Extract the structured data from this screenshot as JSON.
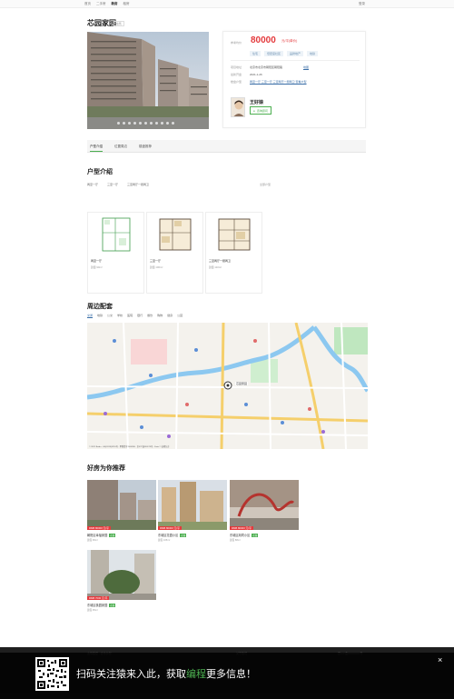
{
  "nav": {
    "links": [
      "首页",
      "二手房",
      "新房",
      "租房"
    ],
    "active_index": 2,
    "right": "登录"
  },
  "listing": {
    "title": "芯园家园",
    "title_tag": "在售"
  },
  "price_card": {
    "price_label": "参考均价",
    "price": "80000",
    "price_unit": "元/平(单价)",
    "tags": [
      "住宅",
      "低密度社区",
      "品牌地产",
      "地铁"
    ],
    "rows": [
      {
        "label": "项目地址",
        "value": "北京市北京市朝阳区朝阳路",
        "link": "地图"
      },
      {
        "label": "最新开盘",
        "value": "2021-1-26",
        "link": ""
      },
      {
        "label": "楼盘户型",
        "value": "",
        "link": "两室一厅  三室一厅  三室两厅一厨两卫  查看户型"
      }
    ],
    "agent_name": "王好娘",
    "agent_button": "咨询顾问"
  },
  "tabs": [
    "户型介绍",
    "位置周边",
    "楼盘推荐"
  ],
  "layout_section": {
    "title": "户型介绍",
    "filters": [
      "两室一厅",
      "三室一厅",
      "三室两厅一厨两卫"
    ],
    "all_link": "全部户型",
    "plans": [
      {
        "name": "两室一厅",
        "area": "建面 90m²"
      },
      {
        "name": "三室一厅",
        "area": "建面 100m²"
      },
      {
        "name": "三室两厅一厨两卫",
        "area": "建面 110m²"
      }
    ]
  },
  "map_section": {
    "title": "周边配套",
    "categories": [
      "交通",
      "地铁",
      "公交",
      "学校",
      "医院",
      "银行",
      "餐饮",
      "购物",
      "健身",
      "公园"
    ],
    "active_index": 0,
    "marker_label": "芯园家园",
    "copyright": "© 2021 Baidu - GS(2019)5218号 - 甲测资字1100930 - 京ICP证030173号 - Data © 长地万方"
  },
  "recommend": {
    "title": "好房为你推荐",
    "items": [
      {
        "badge": "RMB 80000 元/平",
        "name": "朝阳区幸福家园",
        "tag": "在售",
        "area": "建面 96m²"
      },
      {
        "badge": "RMB 80000 元/平",
        "name": "东城区花园小区",
        "tag": "在售",
        "area": "建面 105m²"
      },
      {
        "badge": "RMB 80000 元/平",
        "name": "东城区胡同小区",
        "tag": "在售",
        "area": "建面 88m²"
      },
      {
        "badge": "RMB 7000 元/平",
        "name": "东城区桃园家园",
        "tag": "在售",
        "area": "建面 95m²"
      }
    ]
  },
  "footer": {
    "left": "友情链接 · 合作伙伴",
    "mid": "关于我们",
    "right": "京ICP备00000000号"
  },
  "qr_banner": {
    "text_before": "扫码关注猿来入此，获取",
    "highlight": "编程",
    "text_after": "更多信息！",
    "close": "×"
  }
}
